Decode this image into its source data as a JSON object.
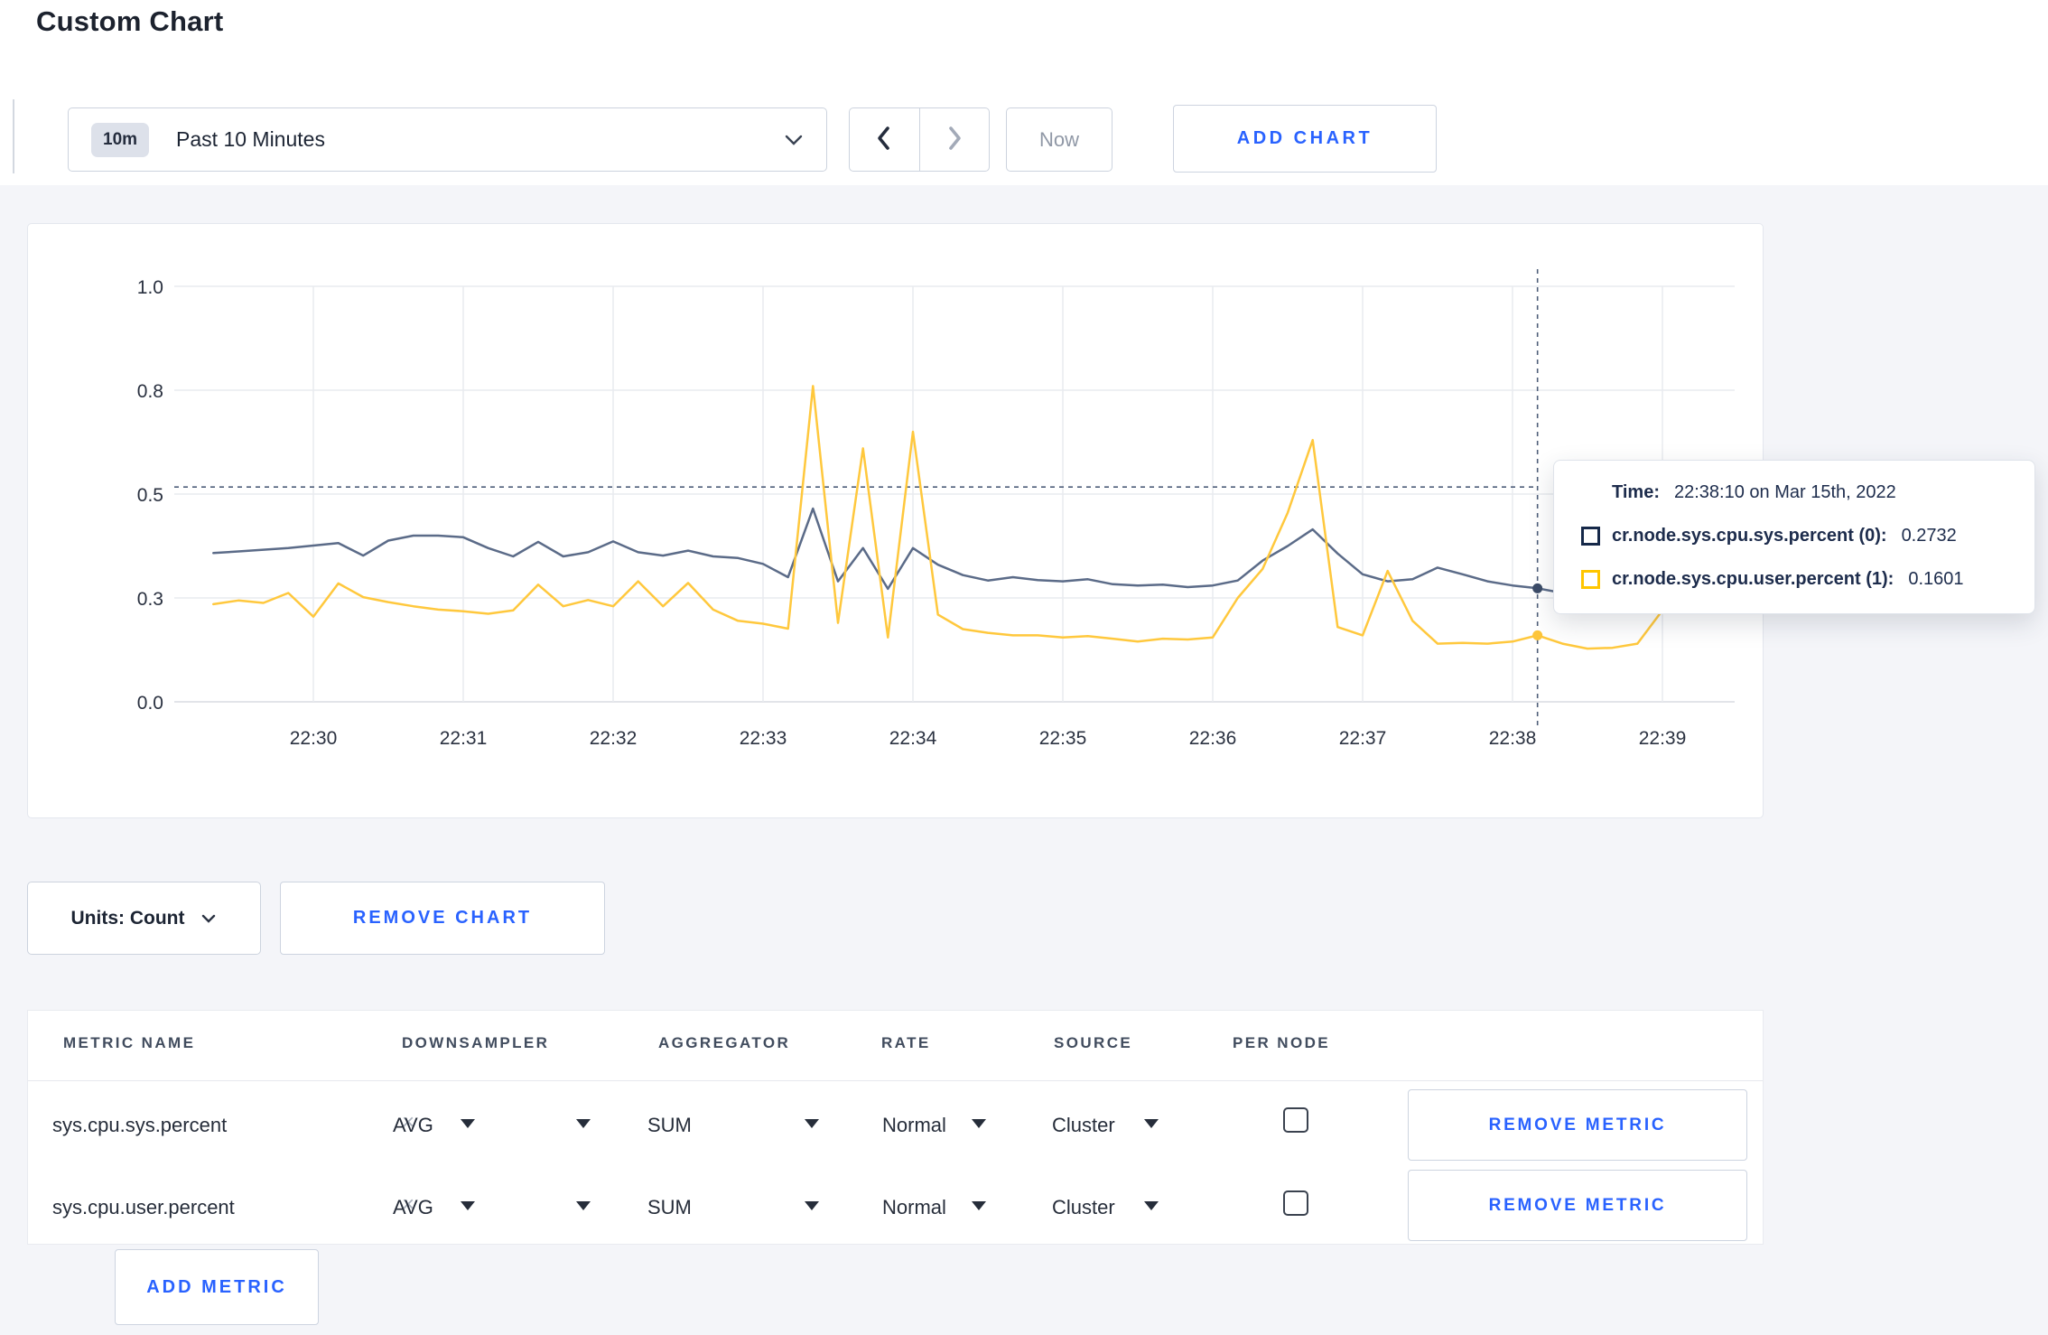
{
  "page": {
    "title": "Custom Chart"
  },
  "toolbar": {
    "time_range": {
      "badge": "10m",
      "label": "Past 10 Minutes"
    },
    "now_label": "Now",
    "add_chart_label": "ADD CHART"
  },
  "chart_data": {
    "type": "line",
    "title": "",
    "xlabel": "",
    "ylabel": "",
    "ylim": [
      0,
      1
    ],
    "grid": true,
    "legend_position": "tooltip",
    "y_ticks": [
      {
        "value": 0,
        "label": "0.0"
      },
      {
        "value": 0.25,
        "label": "0.3"
      },
      {
        "value": 0.5,
        "label": "0.5"
      },
      {
        "value": 0.75,
        "label": "0.8"
      },
      {
        "value": 1,
        "label": "1.0"
      }
    ],
    "x_ticks": [
      "22:30",
      "22:31",
      "22:32",
      "22:33",
      "22:34",
      "22:35",
      "22:36",
      "22:37",
      "22:38",
      "22:39"
    ],
    "x_start_offset_sec": -40,
    "x_step_sec": 10,
    "series": [
      {
        "key": "cr.node.sys.cpu.sys.percent",
        "label": "cr.node.sys.cpu.sys.percent (0)",
        "color": "#5b6b88",
        "dot_color": "#3c4c68",
        "values": [
          0.358,
          0.362,
          0.366,
          0.37,
          0.376,
          0.382,
          0.352,
          0.388,
          0.4,
          0.4,
          0.396,
          0.37,
          0.35,
          0.385,
          0.35,
          0.36,
          0.386,
          0.36,
          0.352,
          0.364,
          0.35,
          0.346,
          0.332,
          0.3,
          0.465,
          0.29,
          0.37,
          0.272,
          0.37,
          0.33,
          0.305,
          0.292,
          0.3,
          0.293,
          0.29,
          0.295,
          0.283,
          0.28,
          0.282,
          0.276,
          0.28,
          0.292,
          0.34,
          0.375,
          0.415,
          0.357,
          0.307,
          0.29,
          0.295,
          0.323,
          0.307,
          0.29,
          0.28,
          0.2732,
          0.262,
          0.258,
          0.266,
          0.29,
          0.28,
          0.276,
          0.274
        ]
      },
      {
        "key": "cr.node.sys.cpu.user.percent",
        "label": "cr.node.sys.cpu.user.percent (1)",
        "color": "#ffc83d",
        "dot_color": "#fdc53a",
        "values": [
          0.235,
          0.244,
          0.238,
          0.262,
          0.205,
          0.285,
          0.252,
          0.24,
          0.23,
          0.222,
          0.218,
          0.212,
          0.22,
          0.282,
          0.23,
          0.245,
          0.23,
          0.29,
          0.23,
          0.286,
          0.222,
          0.195,
          0.188,
          0.176,
          0.76,
          0.19,
          0.61,
          0.155,
          0.65,
          0.21,
          0.175,
          0.166,
          0.16,
          0.16,
          0.155,
          0.158,
          0.152,
          0.145,
          0.152,
          0.15,
          0.155,
          0.25,
          0.32,
          0.455,
          0.63,
          0.18,
          0.16,
          0.315,
          0.195,
          0.14,
          0.142,
          0.14,
          0.145,
          0.1601,
          0.14,
          0.128,
          0.13,
          0.14,
          0.22,
          0.262,
          0.24
        ]
      }
    ],
    "crosshair": {
      "time_offset_sec": 490,
      "index": 53,
      "hline_value": 0.517,
      "time": "22:38:10"
    }
  },
  "tooltip": {
    "time_label": "Time:",
    "time_value": "22:38:10 on Mar 15th, 2022",
    "series": [
      {
        "name": "cr.node.sys.cpu.sys.percent (0):",
        "value": "0.2732",
        "color": "#152849"
      },
      {
        "name": "cr.node.sys.cpu.user.percent (1):",
        "value": "0.1601",
        "color": "#ffc600"
      }
    ]
  },
  "chart_controls": {
    "units_label": "Units: Count",
    "remove_chart_label": "REMOVE CHART"
  },
  "metrics_table": {
    "headers": [
      "METRIC NAME",
      "DOWNSAMPLER",
      "AGGREGATOR",
      "RATE",
      "SOURCE",
      "PER NODE"
    ],
    "rows": [
      {
        "metric": "sys.cpu.sys.percent",
        "clear": "×",
        "downsampler": "AVG",
        "aggregator": "SUM",
        "rate": "Normal",
        "source": "Cluster",
        "per_node": false,
        "remove_label": "REMOVE METRIC"
      },
      {
        "metric": "sys.cpu.user.percent",
        "clear": "×",
        "downsampler": "AVG",
        "aggregator": "SUM",
        "rate": "Normal",
        "source": "Cluster",
        "per_node": false,
        "remove_label": "REMOVE METRIC"
      }
    ],
    "add_metric_label": "ADD METRIC"
  },
  "colors": {
    "accent_blue": "#2962ff",
    "series_sys": "#5b6b88",
    "series_user": "#ffc83d",
    "page_bg": "#f4f5f9"
  }
}
